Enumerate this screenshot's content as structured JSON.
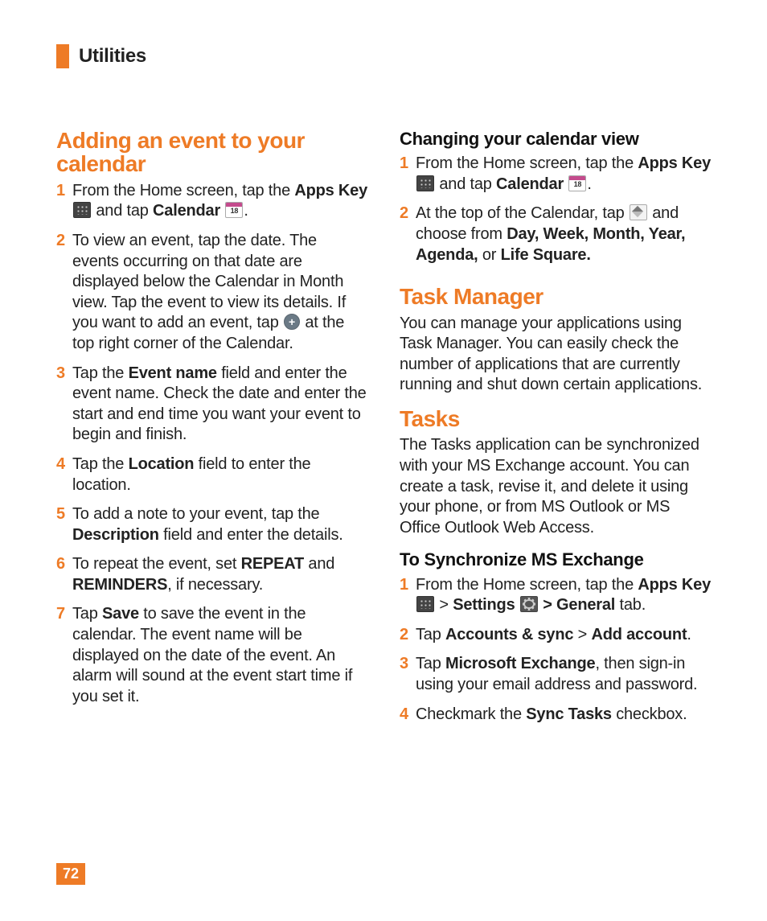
{
  "header": {
    "title": "Utilities"
  },
  "page_number": "72",
  "left_col": {
    "h_adding": "Adding an event to your calendar",
    "steps_adding": {
      "1a": "From the Home screen, tap the ",
      "1b": "Apps Key",
      "1c": " and tap ",
      "1d": "Calendar",
      "1e": ".",
      "2a": "To view an event, tap the date. The events occurring on that date are displayed below the Calendar in Month view. Tap the event to view its details. If you want to add an event, tap ",
      "2b": " at the top right corner of the Calendar.",
      "3a": "Tap the ",
      "3b": "Event name",
      "3c": " field and enter the event name. Check the date and enter the start and end time you want your event to begin and finish.",
      "4a": "Tap the ",
      "4b": "Location",
      "4c": " field to enter the location.",
      "5a": "To add a note to your event, tap the ",
      "5b": "Description",
      "5c": " field and enter the details.",
      "6a": "To repeat the event, set ",
      "6b": "REPEAT",
      "6c": " and ",
      "6d": "REMINDERS",
      "6e": ", if necessary.",
      "7a": "Tap ",
      "7b": "Save",
      "7c": " to save the event in the calendar. The event name will be displayed on the date of the event. An alarm will sound at the event start time if you set it."
    }
  },
  "right_col": {
    "h_change": "Changing your calendar view",
    "steps_change": {
      "1a": "From the Home screen, tap the ",
      "1b": "Apps Key",
      "1c": " and tap ",
      "1d": "Calendar",
      "1e": ".",
      "2a": "At the top of the Calendar, tap ",
      "2b": " and choose from ",
      "2c": "Day, Week, Month, Year, Agenda,",
      "2d": " or ",
      "2e": "Life Square."
    },
    "h_taskmgr": "Task Manager",
    "p_taskmgr": "You can manage your applications using Task Manager. You can easily check the number of applications that are currently running and shut down certain applications.",
    "h_tasks": "Tasks",
    "p_tasks": "The Tasks application can be synchronized with your MS Exchange account. You can create a task, revise it, and delete it using your phone, or from MS Outlook or MS Office Outlook Web Access.",
    "h_sync": "To Synchronize MS Exchange",
    "steps_sync": {
      "1a": "From the Home screen, tap the ",
      "1b": "Apps Key",
      "1c": " > ",
      "1d": "Settings",
      "1e": " > General",
      "1f": " tab.",
      "2a": "Tap ",
      "2b": "Accounts & sync",
      "2c": " > ",
      "2d": "Add account",
      "2e": ".",
      "3a": "Tap ",
      "3b": "Microsoft Exchange",
      "3c": ", then sign-in using your email address and password.",
      "4a": "Checkmark the ",
      "4b": "Sync Tasks",
      "4c": " checkbox."
    }
  }
}
